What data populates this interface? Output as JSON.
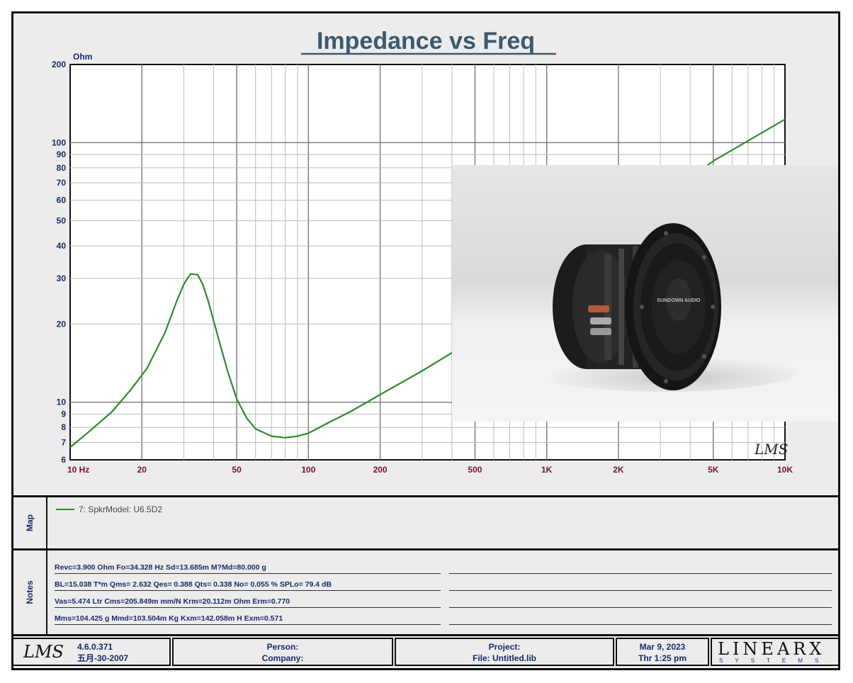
{
  "chart_data": {
    "type": "line",
    "title": "Impedance vs Freq",
    "y_unit": "Ohm",
    "x_scale": "log",
    "y_scale": "log",
    "xlim": [
      10,
      10000
    ],
    "ylim": [
      6,
      200
    ],
    "x_ticks": [
      "10  Hz",
      "20",
      "50",
      "100",
      "200",
      "500",
      "1K",
      "2K",
      "5K",
      "10K"
    ],
    "x_tick_values": [
      10,
      20,
      50,
      100,
      200,
      500,
      1000,
      2000,
      5000,
      10000
    ],
    "y_ticks": [
      "200",
      "100",
      "90",
      "80",
      "70",
      "60",
      "50",
      "40",
      "30",
      "20",
      "10",
      "9",
      "8",
      "7",
      "6"
    ],
    "y_tick_values": [
      200,
      100,
      90,
      80,
      70,
      60,
      50,
      40,
      30,
      20,
      10,
      9,
      8,
      7,
      6
    ],
    "grid": true,
    "series": [
      {
        "name": "7: SpkrModel: U6.5D2",
        "color": "#2e8b2e",
        "x": [
          10,
          12,
          15,
          18,
          21,
          25,
          28,
          30,
          32,
          34.3,
          36,
          38,
          42,
          46,
          50,
          55,
          60,
          70,
          80,
          90,
          100,
          120,
          150,
          200,
          300,
          400,
          500,
          700,
          1000,
          2000,
          3000,
          5000,
          10000
        ],
        "y": [
          6.7,
          7.7,
          9.2,
          11.2,
          13.5,
          18.5,
          24.5,
          28.5,
          31.2,
          31.0,
          28.5,
          24.5,
          17.5,
          13.0,
          10.3,
          8.7,
          7.9,
          7.4,
          7.3,
          7.4,
          7.6,
          8.3,
          9.2,
          10.7,
          13.2,
          15.5,
          17.8,
          21.8,
          27,
          44,
          60,
          85,
          123
        ]
      }
    ]
  },
  "map": {
    "label": "Map",
    "legend_text": "7: SpkrModel: U6.5D2",
    "legend_color": "#2e8b2e"
  },
  "notes": {
    "label": "Notes",
    "lines": [
      "Revc=3.900 Ohm  Fo=34.328 Hz  Sd=13.685m M?Md=80.000 g",
      "BL=15.038 T*m  Qms= 2.632  Qes= 0.388  Qts= 0.338  No= 0.055 %  SPLo= 79.4 dB",
      "Vas=5.474 Ltr  Cms=205.849m mm/N  Krm=20.112m Ohm  Erm=0.770",
      "Mms=104.425 g  Mmd=103.504m Kg  Kxm=142.058m H  Exm=0.571"
    ]
  },
  "footer": {
    "logo": "LMS",
    "version": "4.6.0.371",
    "build_date": "五月-30-2007",
    "person_label": "Person:",
    "company_label": "Company:",
    "project_label": "Project:",
    "file_label": "File: Untitled.lib",
    "date": "Mar  9, 2023",
    "time": "Thr  1:25 pm",
    "brand": "LINEARX",
    "brand_sub": "SYSTEMS"
  },
  "watermark": "LMS",
  "product_photo": {
    "badge_text": "SUNDOWN AUDIO"
  }
}
